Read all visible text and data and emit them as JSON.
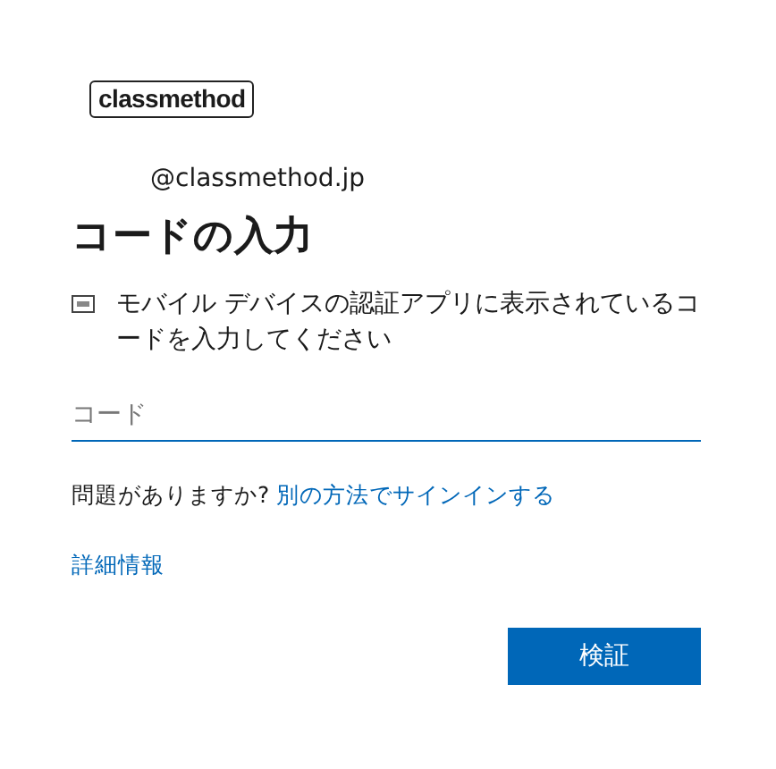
{
  "logo": {
    "text": "classmethod"
  },
  "account": {
    "email": "@classmethod.jp"
  },
  "title": "コードの入力",
  "instruction": {
    "text": "モバイル デバイスの認証アプリに表示されているコードを入力してください"
  },
  "code_field": {
    "placeholder": "コード",
    "focused": true
  },
  "help": {
    "text": "問題がありますか?",
    "link": "別の方法でサインインする"
  },
  "more_info_link": "詳細情報",
  "buttons": [
    {
      "label": "検証",
      "kind": "primary"
    }
  ]
}
